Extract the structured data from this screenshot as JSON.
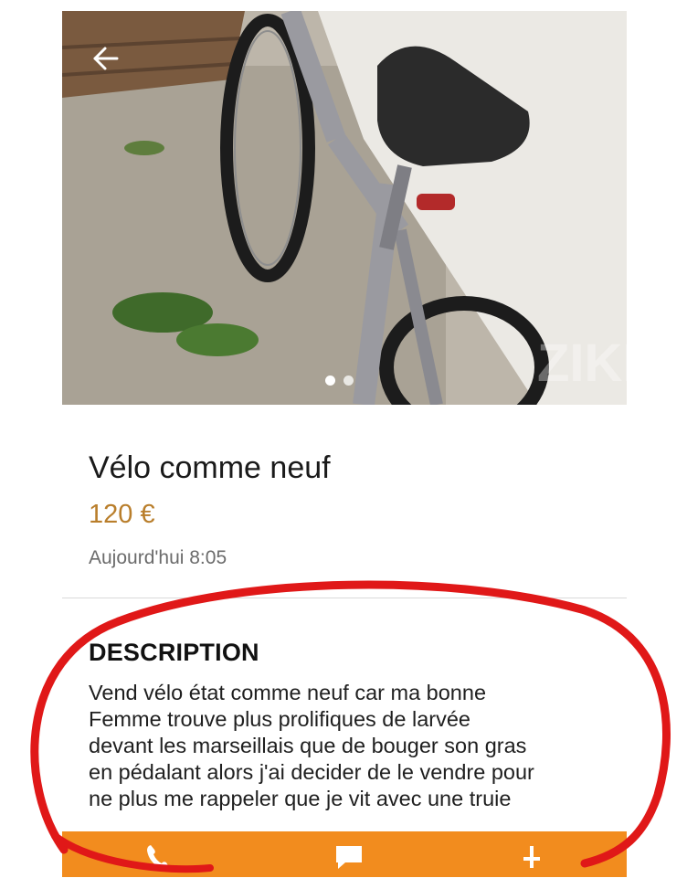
{
  "listing": {
    "title": "Vélo comme neuf",
    "price": "120 €",
    "date": "Aujourd'hui 8:05",
    "description_heading": "DESCRIPTION",
    "description_lines": [
      "Vend vélo état comme neuf car ma bonne",
      "Femme trouve plus prolifiques de larvée",
      "devant les marseillais que de bouger son gras",
      "en pédalant alors j'ai decider de le vendre pour",
      "ne plus me rappeler que je vit avec une truie"
    ]
  },
  "photo": {
    "carousel_total": 2,
    "carousel_active": 1,
    "watermark": "ZIKISS"
  },
  "icons": {
    "back": "arrow-left-icon",
    "call": "phone-icon",
    "message": "chat-bubble-icon",
    "share": "share-icon"
  },
  "colors": {
    "accent": "#f28c1e",
    "price": "#b97e2b",
    "annotation": "#e01818"
  }
}
